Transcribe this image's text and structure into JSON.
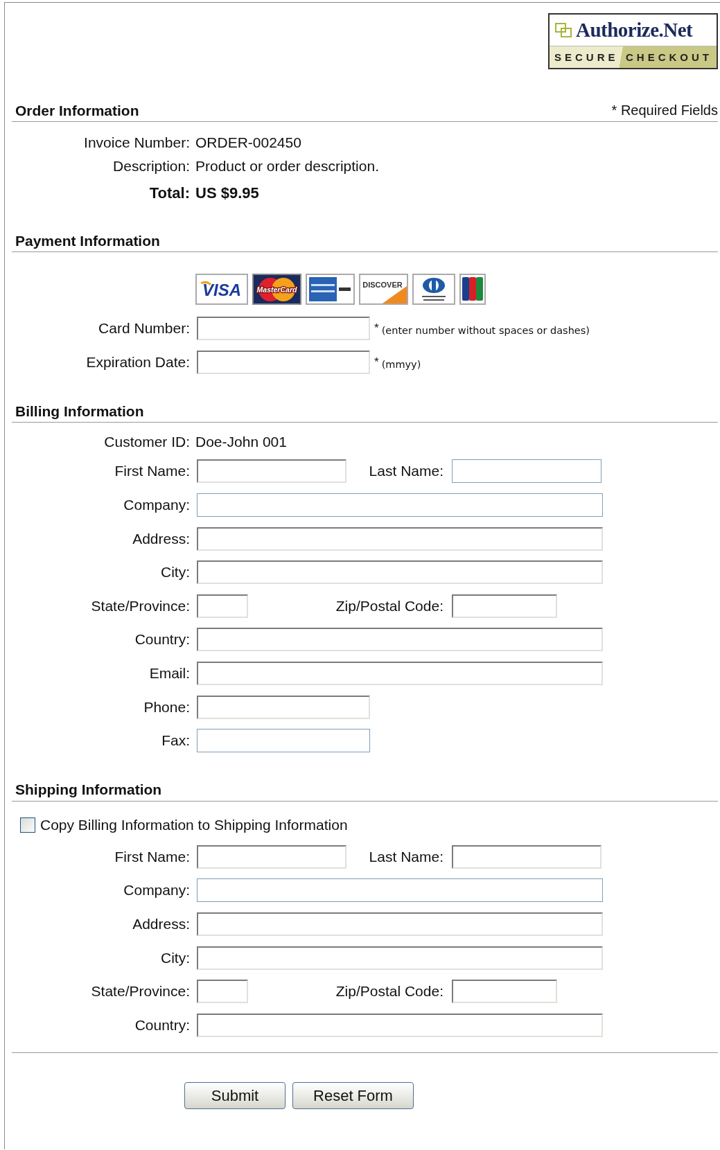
{
  "logo": {
    "brand": "Authorize.Net",
    "left": "SECURE",
    "right": "CHECKOUT"
  },
  "order": {
    "title": "Order Information",
    "required_note": "* Required Fields",
    "rows": [
      {
        "label": "Invoice Number:",
        "value": "ORDER-002450",
        "kind": "plain"
      },
      {
        "label": "Description:",
        "value": "Product or order description.",
        "kind": "plain"
      },
      {
        "label": "Total:",
        "value": "US $9.95",
        "kind": "total"
      }
    ]
  },
  "payment": {
    "title": "Payment Information",
    "cards": [
      {
        "kind": "visa",
        "text": "VISA"
      },
      {
        "kind": "mastercard",
        "text": "MasterCard"
      },
      {
        "kind": "amex"
      },
      {
        "kind": "discover",
        "text": "DISCOVER"
      },
      {
        "kind": "diners"
      },
      {
        "kind": "jcb"
      }
    ],
    "rows": [
      {
        "fields": [
          {
            "label": "Card Number:",
            "kind": "medium",
            "highlighted": false,
            "required_mark": "*",
            "hint": "(enter number without spaces or dashes)"
          }
        ]
      },
      {
        "fields": [
          {
            "label": "Expiration Date:",
            "kind": "medium",
            "highlighted": false,
            "required_mark": "*",
            "hint": "(mmyy)"
          }
        ]
      }
    ]
  },
  "billing": {
    "title": "Billing Information",
    "info": {
      "label": "Customer ID:",
      "value": "Doe-John 001"
    },
    "rows": [
      {
        "fields": [
          {
            "label": "First Name:",
            "kind": "short",
            "highlighted": false
          },
          {
            "label": "Last Name:",
            "kind": "short",
            "highlighted": true
          }
        ]
      },
      {
        "fields": [
          {
            "label": "Company:",
            "kind": "long",
            "highlighted": true
          }
        ]
      },
      {
        "fields": [
          {
            "label": "Address:",
            "kind": "long",
            "highlighted": false
          }
        ]
      },
      {
        "fields": [
          {
            "label": "City:",
            "kind": "long",
            "highlighted": false
          }
        ]
      },
      {
        "fields": [
          {
            "label": "State/Province:",
            "kind": "tiny",
            "highlighted": false
          },
          {
            "label": "Zip/Postal Code:",
            "kind": "small",
            "highlighted": false
          }
        ]
      },
      {
        "fields": [
          {
            "label": "Country:",
            "kind": "long",
            "highlighted": false
          }
        ]
      },
      {
        "fields": [
          {
            "label": "Email:",
            "kind": "long",
            "highlighted": false
          }
        ]
      },
      {
        "fields": [
          {
            "label": "Phone:",
            "kind": "medium",
            "highlighted": false
          }
        ]
      },
      {
        "fields": [
          {
            "label": "Fax:",
            "kind": "medium",
            "highlighted": true
          }
        ]
      }
    ]
  },
  "shipping": {
    "title": "Shipping Information",
    "copy": {
      "label": "Copy Billing Information to Shipping Information",
      "checked": false
    },
    "rows": [
      {
        "fields": [
          {
            "label": "First Name:",
            "kind": "short",
            "highlighted": false
          },
          {
            "label": "Last Name:",
            "kind": "short",
            "highlighted": false
          }
        ]
      },
      {
        "fields": [
          {
            "label": "Company:",
            "kind": "long",
            "highlighted": true
          }
        ]
      },
      {
        "fields": [
          {
            "label": "Address:",
            "kind": "long",
            "highlighted": false
          }
        ]
      },
      {
        "fields": [
          {
            "label": "City:",
            "kind": "long",
            "highlighted": false
          }
        ]
      },
      {
        "fields": [
          {
            "label": "State/Province:",
            "kind": "tiny",
            "highlighted": false
          },
          {
            "label": "Zip/Postal Code:",
            "kind": "small",
            "highlighted": false
          }
        ]
      },
      {
        "fields": [
          {
            "label": "Country:",
            "kind": "long",
            "highlighted": false
          }
        ]
      }
    ]
  },
  "buttons": [
    {
      "label": "Submit",
      "kind": "submit"
    },
    {
      "label": "Reset Form",
      "kind": "reset"
    }
  ]
}
